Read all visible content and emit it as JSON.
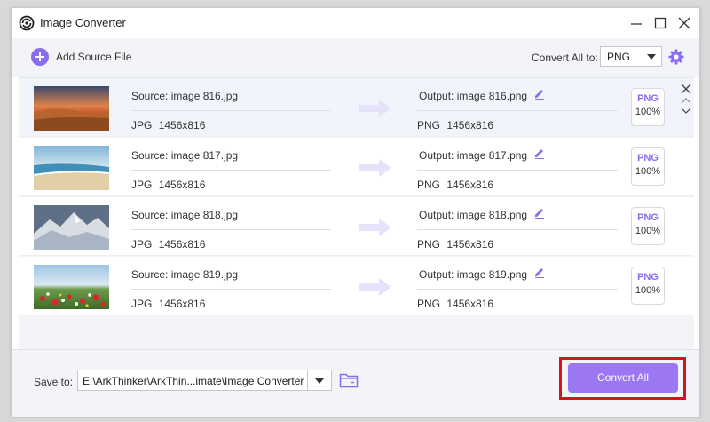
{
  "window": {
    "title": "Image Converter",
    "icon": "converter-logo-icon"
  },
  "window_controls": [
    "minimize-icon",
    "maximize-icon",
    "close-icon"
  ],
  "toolbar": {
    "add_source_label": "Add Source File",
    "convert_all_to_label": "Convert All to:",
    "convert_all_format": "PNG",
    "settings_icon": "gear-icon"
  },
  "files": [
    {
      "source": "Source: image 816.jpg",
      "src_format": "JPG",
      "src_size": "1456x816",
      "output": "Output: image 816.png",
      "out_format": "PNG",
      "out_size": "1456x816",
      "badge_format": "PNG",
      "badge_quality": "100%"
    },
    {
      "source": "Source: image 817.jpg",
      "src_format": "JPG",
      "src_size": "1456x816",
      "output": "Output: image 817.png",
      "out_format": "PNG",
      "out_size": "1456x816",
      "badge_format": "PNG",
      "badge_quality": "100%"
    },
    {
      "source": "Source: image 818.jpg",
      "src_format": "JPG",
      "src_size": "1456x816",
      "output": "Output: image 818.png",
      "out_format": "PNG",
      "out_size": "1456x816",
      "badge_format": "PNG",
      "badge_quality": "100%"
    },
    {
      "source": "Source: image 819.jpg",
      "src_format": "JPG",
      "src_size": "1456x816",
      "output": "Output: image 819.png",
      "out_format": "PNG",
      "out_size": "1456x816",
      "badge_format": "PNG",
      "badge_quality": "100%"
    }
  ],
  "bottom": {
    "save_to_label": "Save to:",
    "save_path": "E:\\ArkThinker\\ArkThin...imate\\Image Converter",
    "convert_all_label": "Convert All"
  },
  "colors": {
    "accent": "#9b77f4",
    "highlight": "#d8141a",
    "format_text": "#8a6cf0"
  }
}
